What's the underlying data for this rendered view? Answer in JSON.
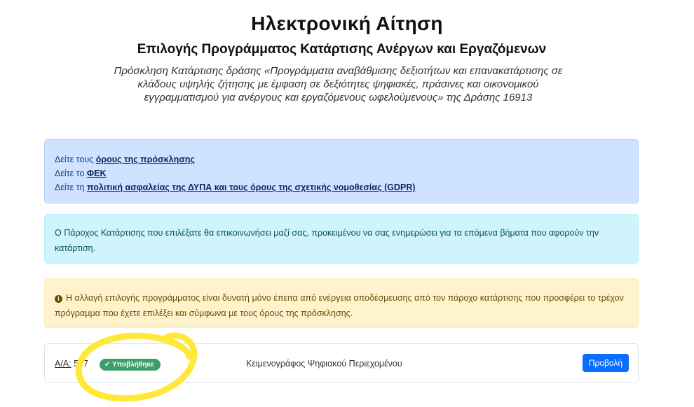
{
  "header": {
    "title": "Ηλεκτρονική Αίτηση",
    "subtitle": "Επιλογής Προγράμματος Κατάρτισης Ανέργων και Εργαζόμενων",
    "intro": "Πρόσκληση Κατάρτισης δράσης «Προγράμματα αναβάθμισης δεξιοτήτων και επανακατάρτισης σε κλάδους υψηλής ζήτησης με έμφαση σε δεξιότητες ψηφιακές, πράσινες και οικονομικού εγγραμματισμού για ανέργους και εργαζόμενους ωφελούμενους» της Δράσης 16913"
  },
  "links_alert": {
    "line1_prefix": "Δείτε τους ",
    "line1_link": "όρους της πρόσκλησης",
    "line2_prefix": "Δείτε το ",
    "line2_link": "ΦΕΚ",
    "line3_prefix": "Δείτε τη ",
    "line3_link": "πολιτική ασφαλείας της ΔΥΠΑ και τους όρους της σχετικής νομοθεσίας (GDPR)"
  },
  "info_alert": {
    "text": "Ο Πάροχος Κατάρτισης που επιλέξατε θα επικοινωνήσει μαζί σας, προκειμένου να σας ενημερώσει για τα επόμενα βήματα που αφορούν την κατάρτιση."
  },
  "warning_alert": {
    "icon": "info-circle-icon",
    "text": "Η αλλαγή επιλογής προγράμματος είναι δυνατή μόνο έπειτα από ενέργεια αποδέσμευσης από τον πάροχο κατάρτισης που προσφέρει το τρέχον πρόγραμμα που έχετε επιλέξει και σύμφωνα με τους όρους της πρόσκλησης."
  },
  "application": {
    "aa_label": "Α/Α:",
    "aa_number": "577",
    "status_badge": "Υποβλήθηκε",
    "status_icon": "checkmark-icon",
    "program_name": "Κειμενογράφος Ψηφιακού Περιεχομένου",
    "view_button": "Προβολή"
  },
  "colors": {
    "primary": "#0d6efd",
    "badge_success": "#3e9e6a",
    "highlight_marker": "#ffe83a"
  }
}
